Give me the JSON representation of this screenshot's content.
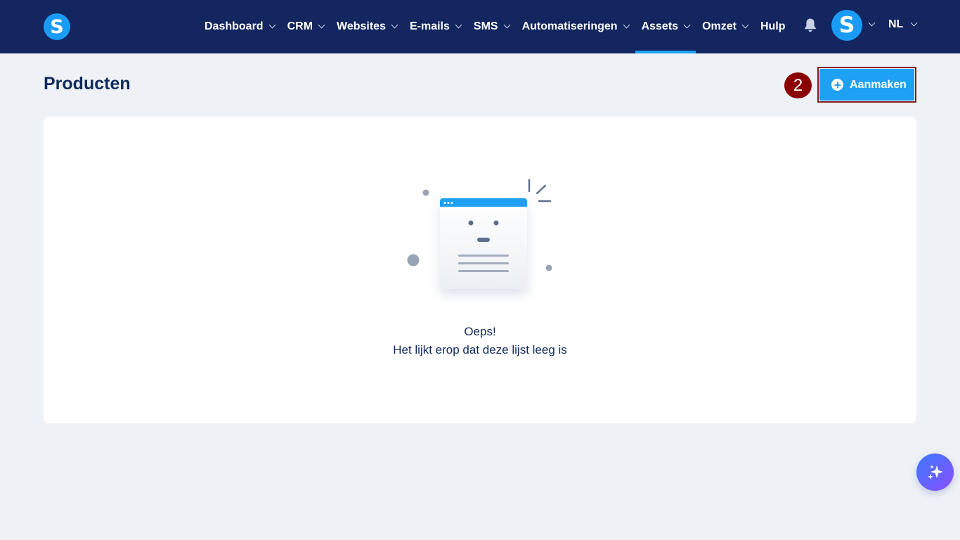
{
  "app": {
    "logo_letter": "S",
    "brand_color": "#1a9bf5",
    "topbar_color": "#13265f"
  },
  "nav": {
    "items": [
      {
        "label": "Dashboard",
        "has_dropdown": true,
        "active": false
      },
      {
        "label": "CRM",
        "has_dropdown": true,
        "active": false
      },
      {
        "label": "Websites",
        "has_dropdown": true,
        "active": false
      },
      {
        "label": "E-mails",
        "has_dropdown": true,
        "active": false
      },
      {
        "label": "SMS",
        "has_dropdown": true,
        "active": false
      },
      {
        "label": "Automatiseringen",
        "has_dropdown": true,
        "active": false
      },
      {
        "label": "Assets",
        "has_dropdown": true,
        "active": true
      },
      {
        "label": "Omzet",
        "has_dropdown": true,
        "active": false
      },
      {
        "label": "Hulp",
        "has_dropdown": false,
        "active": false
      }
    ],
    "notification_icon": "bell-icon",
    "avatar_letter": "S",
    "language": "NL"
  },
  "page": {
    "title": "Producten",
    "step_number": "2",
    "create_button_label": "Aanmaken",
    "create_button_icon": "plus-circle-icon"
  },
  "empty_state": {
    "title": "Oeps!",
    "message": "Het lijkt erop dat deze lijst leeg is",
    "illustration": "empty-window-illustration"
  },
  "fab": {
    "icon": "sparkles-icon",
    "accent_from": "#3b7bff",
    "accent_to": "#8a4dff"
  }
}
